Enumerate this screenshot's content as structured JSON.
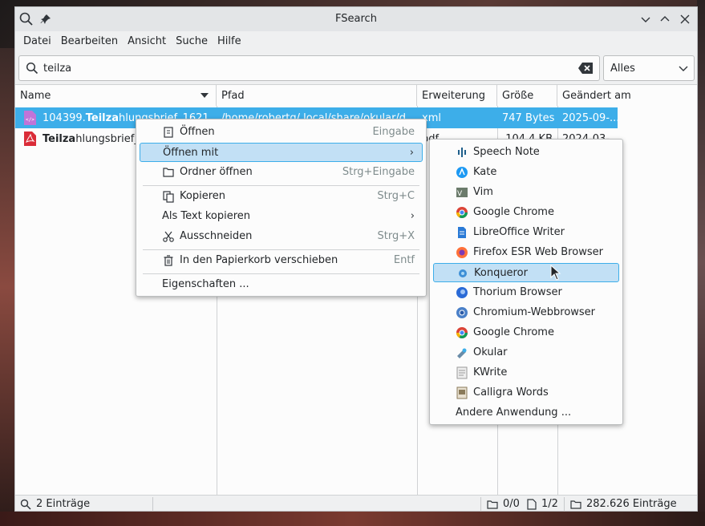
{
  "window": {
    "title": "FSearch"
  },
  "menubar": [
    "Datei",
    "Bearbeiten",
    "Ansicht",
    "Suche",
    "Hilfe"
  ],
  "search": {
    "query": "teilza",
    "filter": "Alles"
  },
  "columns": [
    "Name",
    "Pfad",
    "Erweiterung",
    "Größe",
    "Geändert am"
  ],
  "rows": [
    {
      "name_prefix": "104399.",
      "name_match": "Teilza",
      "name_rest": "hlungsbrief_1621...",
      "path": "/home/robertg/.local/share/okular/d...",
      "ext": "xml",
      "size": "747 Bytes",
      "modified": "2025-09-...",
      "icon": "xml-file-icon"
    },
    {
      "name_prefix": "",
      "name_match": "Teilza",
      "name_rest": "hlungsbrief_",
      "path": "",
      "ext": "pdf",
      "size": "104,4 KB",
      "modified": "2024-03-...",
      "icon": "pdf-file-icon"
    }
  ],
  "context_menu": {
    "open": {
      "label": "Öffnen",
      "shortcut": "Eingabe"
    },
    "open_with": {
      "label": "Öffnen mit"
    },
    "open_folder": {
      "label": "Ordner öffnen",
      "shortcut": "Strg+Eingabe"
    },
    "copy": {
      "label": "Kopieren",
      "shortcut": "Strg+C"
    },
    "copy_as_text": {
      "label": "Als Text kopieren"
    },
    "cut": {
      "label": "Ausschneiden",
      "shortcut": "Strg+X"
    },
    "trash": {
      "label": "In den Papierkorb verschieben",
      "shortcut": "Entf"
    },
    "properties": {
      "label": "Eigenschaften ..."
    }
  },
  "open_with_menu": {
    "apps": [
      {
        "label": "Speech Note",
        "icon": "speech-note-icon"
      },
      {
        "label": "Kate",
        "icon": "kate-icon"
      },
      {
        "label": "Vim",
        "icon": "vim-icon"
      },
      {
        "label": "Google Chrome",
        "icon": "chrome-icon"
      },
      {
        "label": "LibreOffice Writer",
        "icon": "writer-icon"
      },
      {
        "label": "Firefox ESR Web Browser",
        "icon": "firefox-icon"
      },
      {
        "label": "Konqueror",
        "icon": "konqueror-icon"
      },
      {
        "label": "Thorium Browser",
        "icon": "thorium-icon"
      },
      {
        "label": "Chromium-Webbrowser",
        "icon": "chromium-icon"
      },
      {
        "label": "Google Chrome",
        "icon": "chrome-icon"
      },
      {
        "label": "Okular",
        "icon": "okular-icon"
      },
      {
        "label": "KWrite",
        "icon": "kwrite-icon"
      },
      {
        "label": "Calligra Words",
        "icon": "calligra-icon"
      }
    ],
    "other": "Andere Anwendung ..."
  },
  "status": {
    "entries": "2 Einträge",
    "folders": "0/0",
    "files": "1/2",
    "total": "282.626 Einträge"
  },
  "colors": {
    "selection": "#3daee9",
    "highlight": "#c2e0f5"
  }
}
